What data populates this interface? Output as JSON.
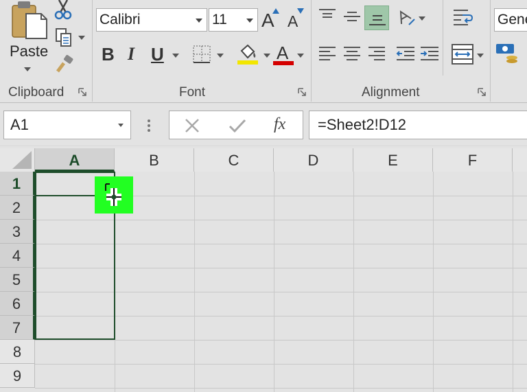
{
  "ribbon": {
    "clipboard": {
      "paste_label": "Paste",
      "group_label": "Clipboard"
    },
    "font": {
      "name": "Calibri",
      "size": "11",
      "bold": "B",
      "italic": "I",
      "underline": "U",
      "grow": "A",
      "shrink": "A",
      "font_color_glyph": "A",
      "group_label": "Font",
      "highlight_color": "#f2e600",
      "font_color": "#d40000"
    },
    "alignment": {
      "group_label": "Alignment",
      "active_color": "#9fc7a9"
    },
    "number": {
      "format": "Gene"
    }
  },
  "formula_bar": {
    "name_box": "A1",
    "fx": "fx",
    "formula": "=Sheet2!D12"
  },
  "sheet": {
    "columns": [
      "A",
      "B",
      "C",
      "D",
      "E",
      "F"
    ],
    "rows": [
      "1",
      "2",
      "3",
      "4",
      "5",
      "6",
      "7",
      "8",
      "9"
    ],
    "selection_color": "#1e4d2b",
    "fill_handle_color": "#22ff22"
  }
}
